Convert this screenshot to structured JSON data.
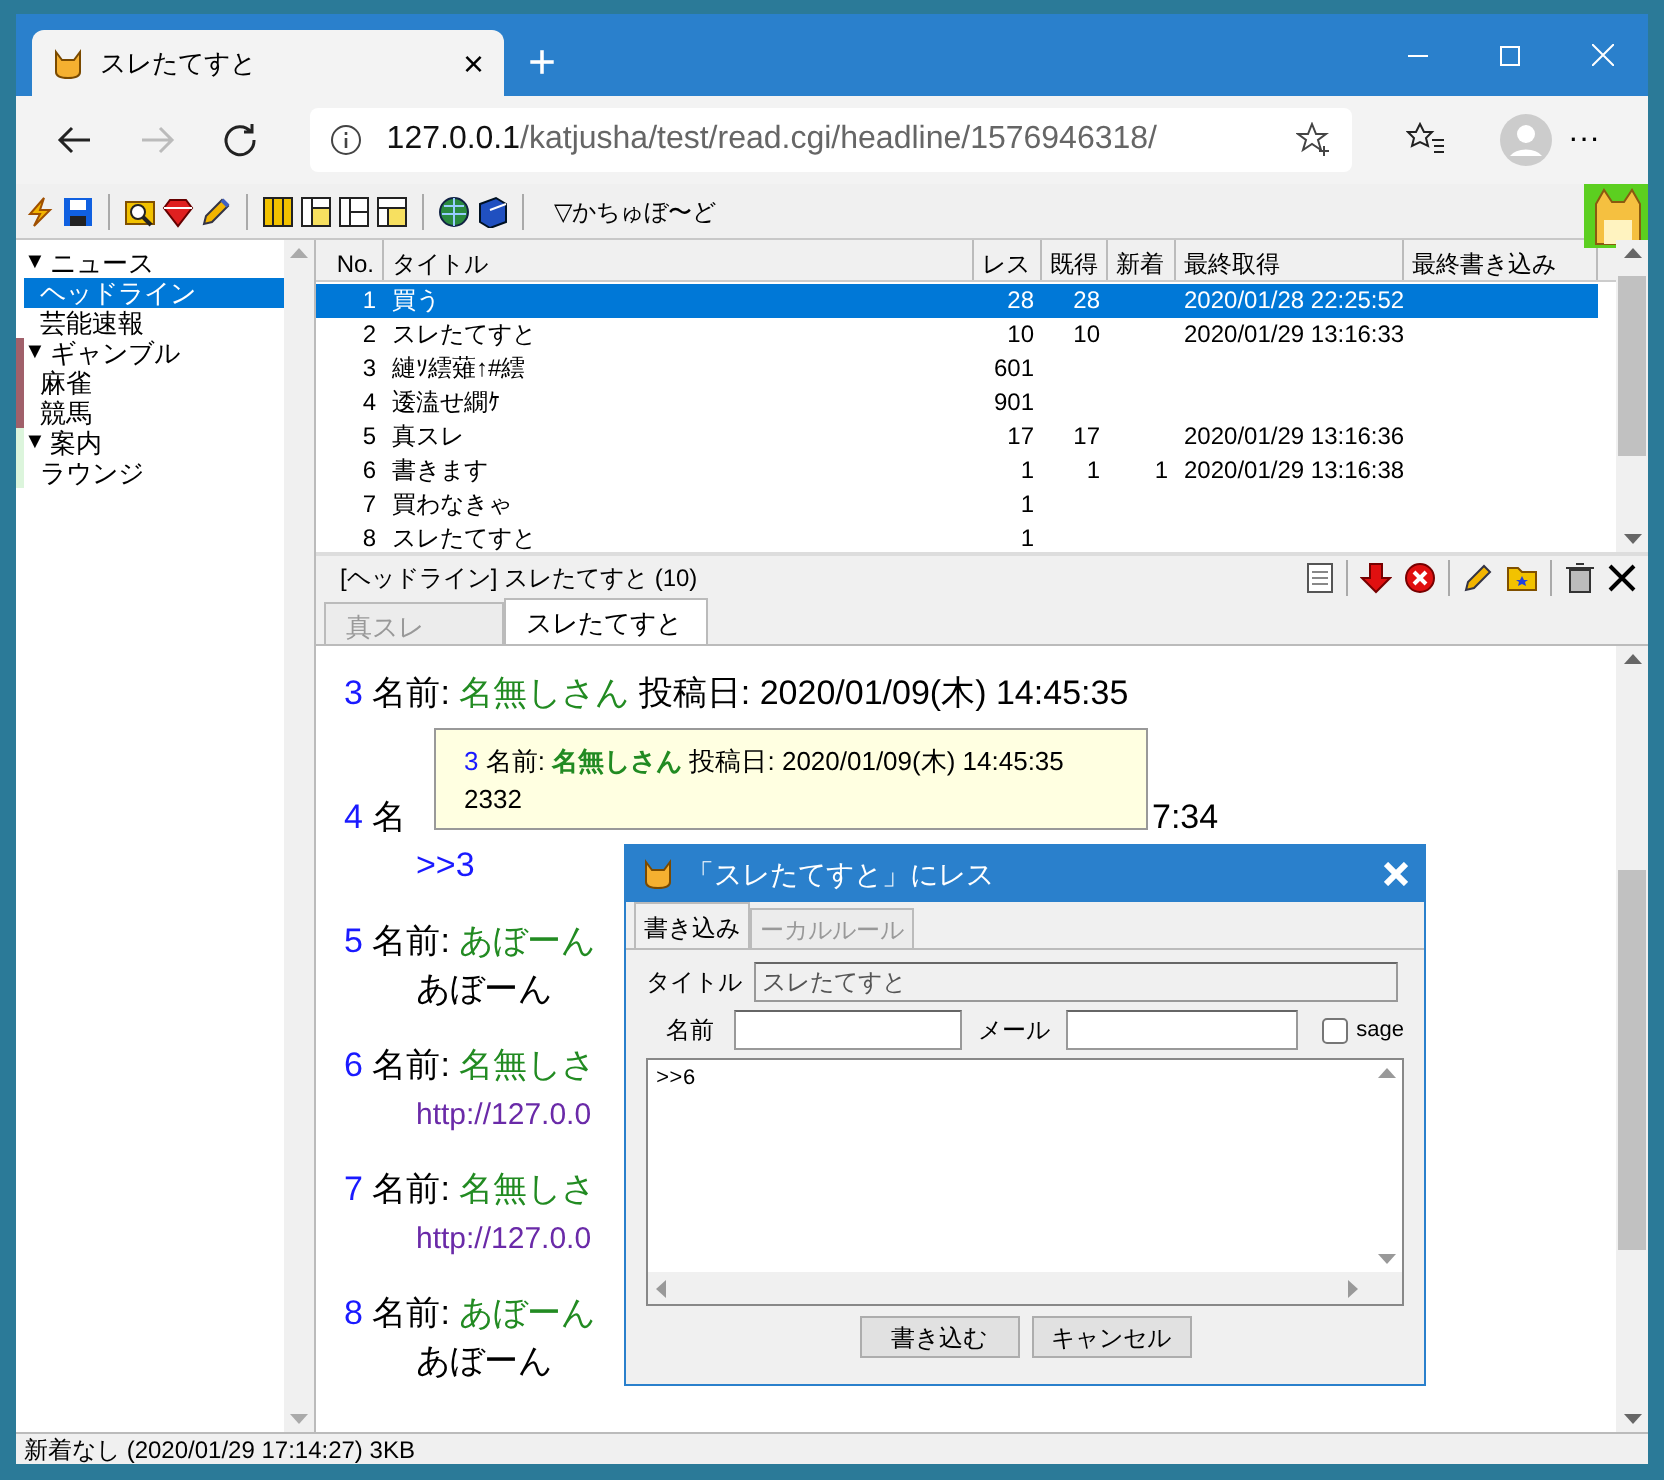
{
  "browser": {
    "tab": {
      "title": "スレたてすと",
      "close": "×"
    },
    "new_tab": "+",
    "url": {
      "host": "127.0.0.1",
      "path": "/katjusha/test/read.cgi/headline/1576946318/"
    },
    "forward_disabled": true,
    "more": "···"
  },
  "toolbar": {
    "board_menu": "▽かちゅぼ〜ど"
  },
  "sidebar": {
    "groups": [
      {
        "label": "ニュース",
        "expander": "▼",
        "expanded": true,
        "children": [
          {
            "label": "ヘッドライン",
            "selected": true
          },
          {
            "label": "芸能速報",
            "selected": false
          }
        ]
      },
      {
        "label": "ギャンブル",
        "expander": "▼",
        "expanded": true,
        "color": "#a0606a",
        "children": [
          {
            "label": "麻雀",
            "selected": false
          },
          {
            "label": "競馬",
            "selected": false
          }
        ]
      },
      {
        "label": "案内",
        "expander": "▼",
        "expanded": true,
        "color": "#dcf5dc",
        "children": [
          {
            "label": "ラウンジ",
            "selected": false
          }
        ]
      }
    ]
  },
  "thread_list": {
    "columns": [
      "No.",
      "タイトル",
      "レス",
      "既得",
      "新着",
      "最終取得",
      "最終書き込み"
    ],
    "rows": [
      {
        "no": "1",
        "title": "買う",
        "res": "28",
        "got": "28",
        "new": "",
        "last_fetch": "2020/01/28 22:25:52",
        "selected": true
      },
      {
        "no": "2",
        "title": "スレたてすと",
        "res": "10",
        "got": "10",
        "new": "",
        "last_fetch": "2020/01/29 13:16:33",
        "selected": false
      },
      {
        "no": "3",
        "title": "縺ｿ繧薙↑#繧",
        "res": "601",
        "got": "",
        "new": "",
        "last_fetch": "",
        "selected": false
      },
      {
        "no": "4",
        "title": "逶溘せ繝ｹ",
        "res": "901",
        "got": "",
        "new": "",
        "last_fetch": "",
        "selected": false
      },
      {
        "no": "5",
        "title": "真スレ",
        "res": "17",
        "got": "17",
        "new": "",
        "last_fetch": "2020/01/29 13:16:36",
        "selected": false
      },
      {
        "no": "6",
        "title": "書きます",
        "res": "1",
        "got": "1",
        "new": "1",
        "last_fetch": "2020/01/29 13:16:38",
        "selected": false
      },
      {
        "no": "7",
        "title": "買わなきゃ",
        "res": "1",
        "got": "",
        "new": "",
        "last_fetch": "",
        "selected": false
      },
      {
        "no": "8",
        "title": "スレたてすと",
        "res": "1",
        "got": "",
        "new": "",
        "last_fetch": "",
        "selected": false
      }
    ]
  },
  "thread_view": {
    "header": "[ヘッドライン] スレたてすと (10)",
    "tabs": [
      {
        "label": "真スレ",
        "selected": false
      },
      {
        "label": "スレたてすと",
        "selected": true
      }
    ],
    "posts": [
      {
        "num": "3",
        "label": "名前:",
        "name": "名無しさん",
        "date": "投稿日: 2020/01/09(木) 14:45:35"
      },
      {
        "num": "4",
        "label": "名",
        "tail": "7:34",
        "body": ">>3",
        "kind": "anchor"
      },
      {
        "num": "5",
        "label": "名前:",
        "name": "あぼーん",
        "body": "あぼーん",
        "kind": "text"
      },
      {
        "num": "6",
        "label": "名前:",
        "name": "名無しさ",
        "body": "http://127.0.0",
        "kind": "link"
      },
      {
        "num": "7",
        "label": "名前:",
        "name": "名無しさ",
        "body": "http://127.0.0",
        "kind": "link"
      },
      {
        "num": "8",
        "label": "名前:",
        "name": "あぼーん",
        "body": "あぼーん",
        "kind": "text"
      }
    ],
    "tooltip": {
      "num": "3",
      "label": "名前:",
      "name": "名無しさん",
      "date": "投稿日: 2020/01/09(木) 14:45:35",
      "body": "2332"
    }
  },
  "reply_dialog": {
    "title": "「スレたてすと」にレス",
    "tabs": [
      {
        "label": "書き込み",
        "selected": true
      },
      {
        "label": "ーカルルール",
        "selected": false
      }
    ],
    "title_label": "タイトル",
    "title_value": "スレたてすと",
    "name_label": "名前",
    "mail_label": "メール",
    "sage": {
      "label": "sage",
      "checked": false
    },
    "message": ">>6",
    "buttons": [
      "書き込む",
      "キャンセル"
    ]
  },
  "status_bar": "新着なし (2020/01/29 17:14:27) 3KB"
}
